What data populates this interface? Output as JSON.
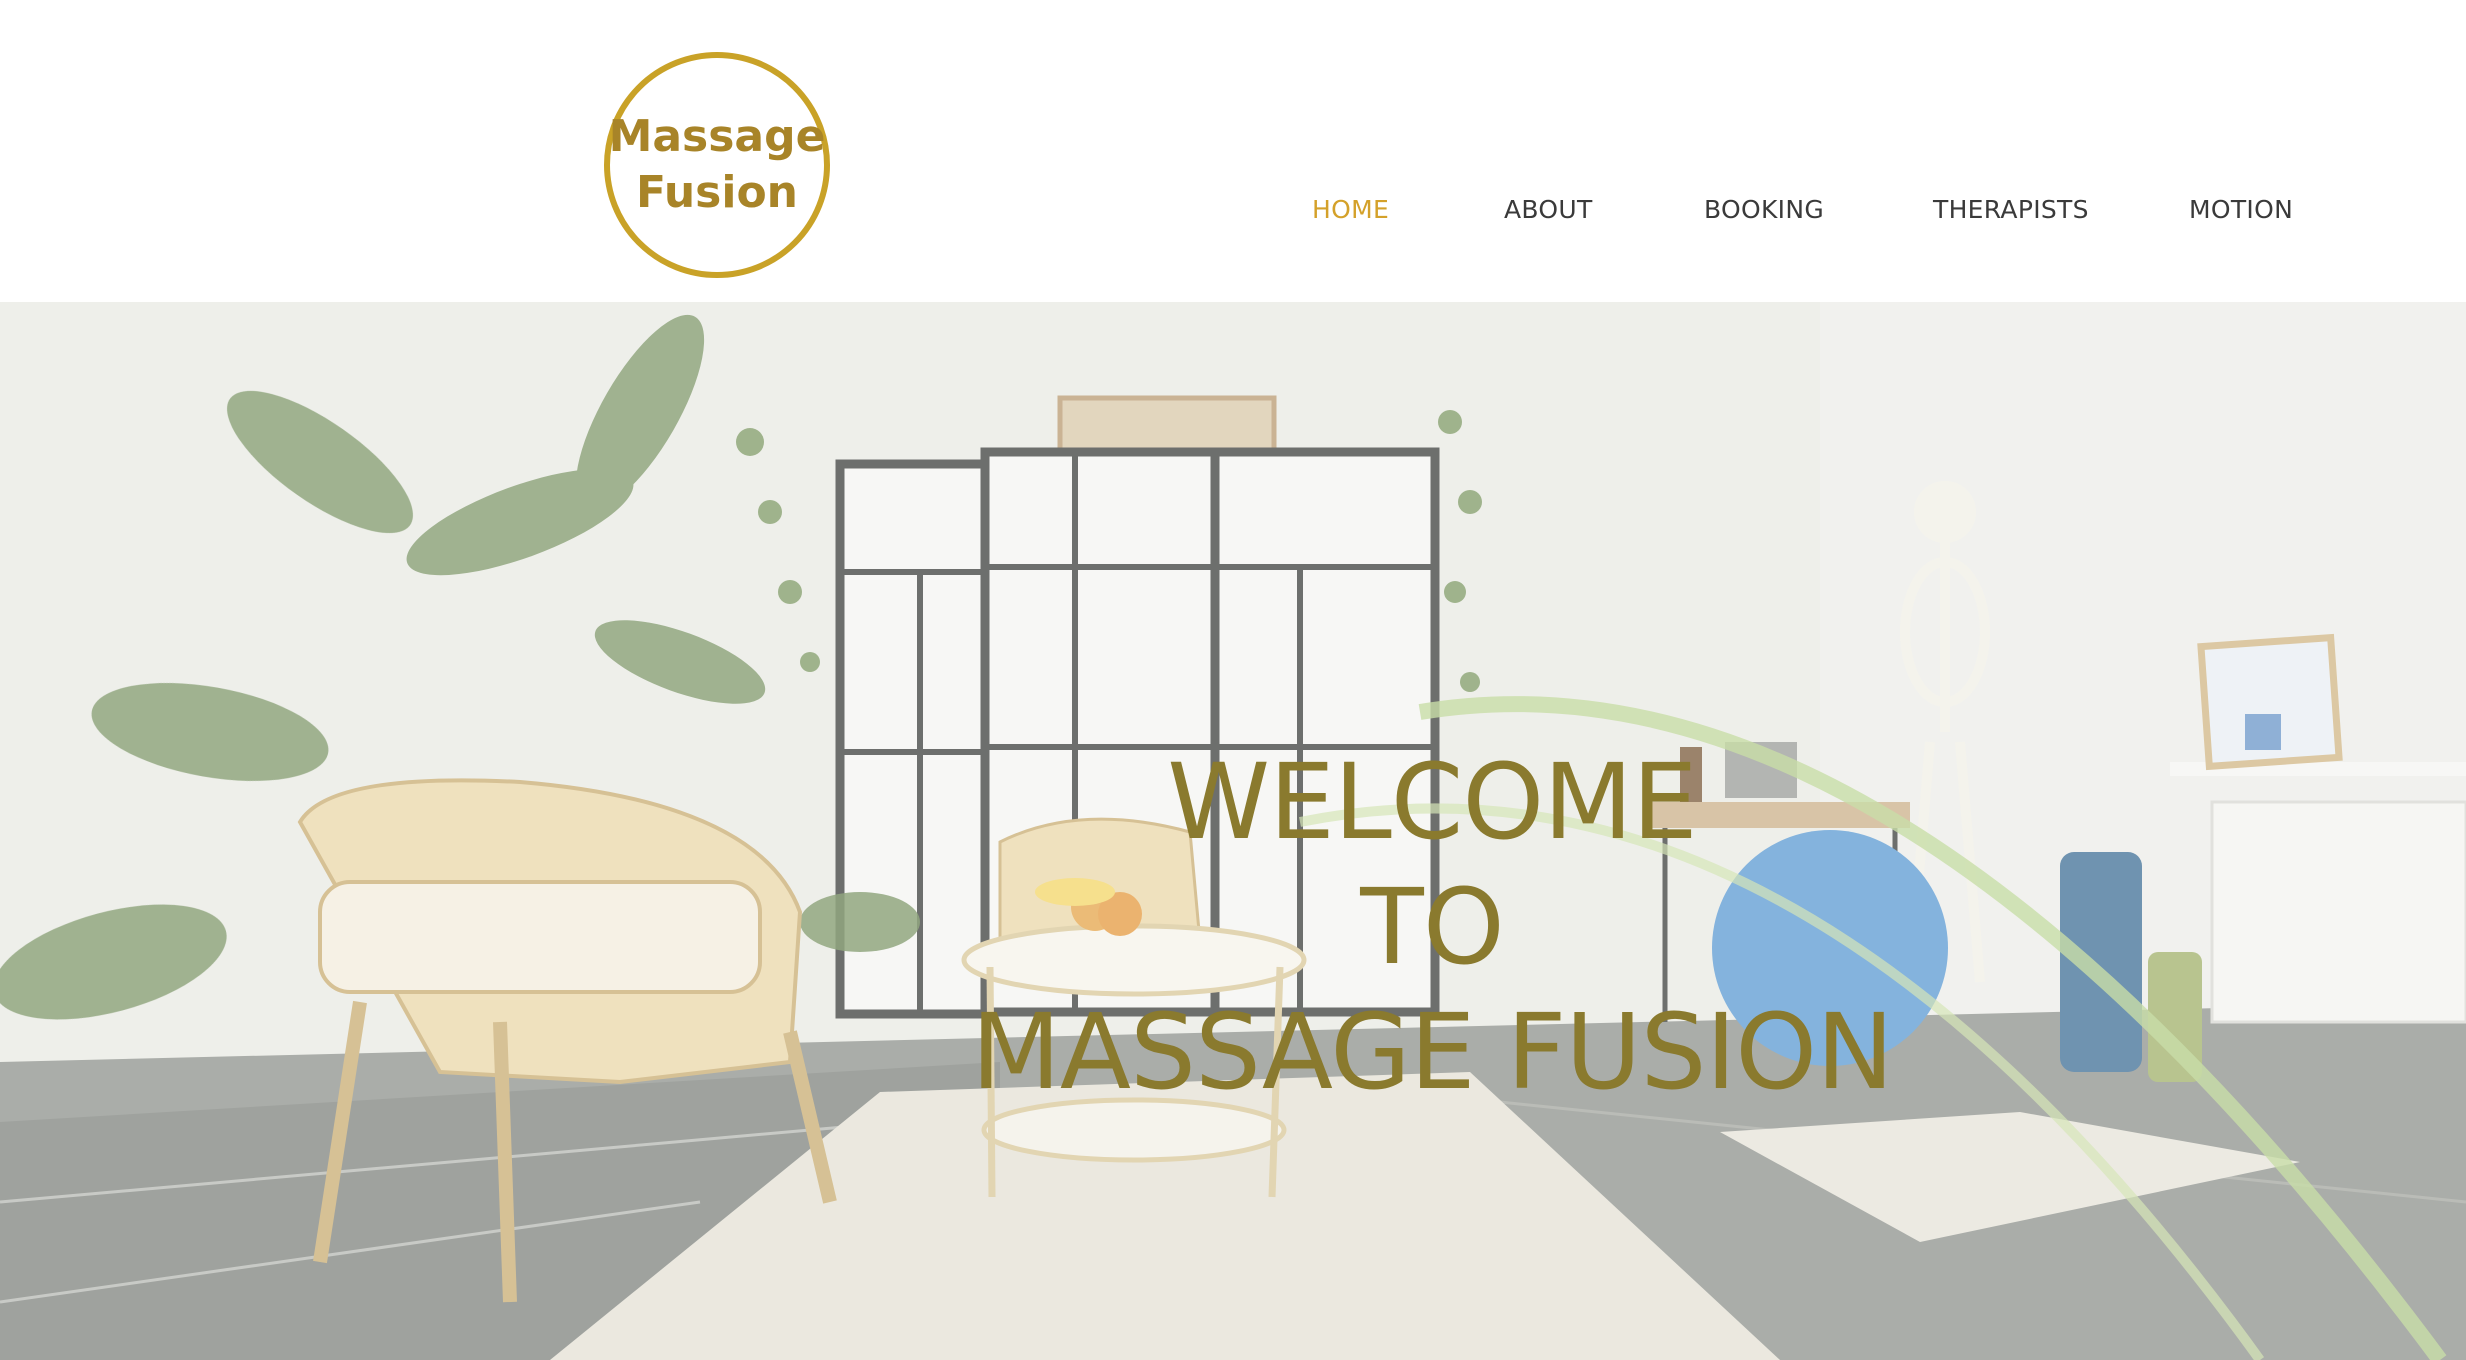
{
  "header": {
    "logo": {
      "line1": "Massage",
      "line2": "Fusion"
    },
    "nav": [
      {
        "label": "HOME",
        "active": true
      },
      {
        "label": "ABOUT",
        "active": false
      },
      {
        "label": "BOOKING",
        "active": false
      },
      {
        "label": "THERAPISTS",
        "active": false
      },
      {
        "label": "MOTION",
        "active": false
      }
    ]
  },
  "hero": {
    "title_lines": [
      "WELCOME",
      "TO",
      "MASSAGE FUSION"
    ],
    "title_color": "#8a7a2e"
  },
  "colors": {
    "accent": "#d4a12a",
    "logo_ring": "#c9a227",
    "logo_text": "#a88428",
    "nav_text": "#3a3a3a"
  }
}
